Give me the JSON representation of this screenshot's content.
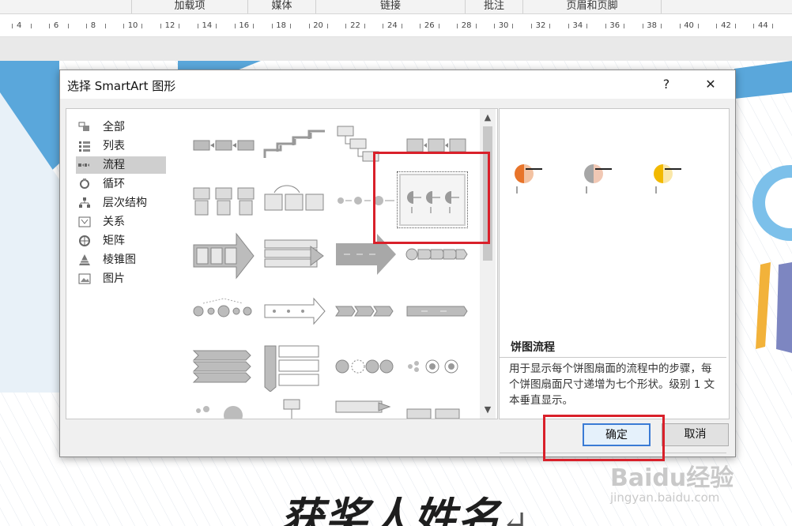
{
  "ribbon": {
    "groups": [
      "加载项",
      "媒体",
      "链接",
      "批注",
      "页眉和页脚"
    ]
  },
  "ruler": {
    "numbers": [
      "4",
      "6",
      "8",
      "10",
      "12",
      "14",
      "16",
      "18",
      "20",
      "22",
      "24",
      "26",
      "28",
      "30",
      "32",
      "34",
      "36",
      "38",
      "40",
      "42",
      "44"
    ]
  },
  "document": {
    "title_text": "获奖人姓名",
    "paragraph_mark": "↵"
  },
  "dialog": {
    "title": "选择 SmartArt 图形",
    "help_label": "?",
    "close_label": "✕",
    "categories": [
      {
        "label": "全部",
        "icon": "all-icon"
      },
      {
        "label": "列表",
        "icon": "list-icon"
      },
      {
        "label": "流程",
        "icon": "process-icon",
        "selected": true
      },
      {
        "label": "循环",
        "icon": "cycle-icon"
      },
      {
        "label": "层次结构",
        "icon": "hierarchy-icon"
      },
      {
        "label": "关系",
        "icon": "relationship-icon"
      },
      {
        "label": "矩阵",
        "icon": "matrix-icon"
      },
      {
        "label": "棱锥图",
        "icon": "pyramid-icon"
      },
      {
        "label": "图片",
        "icon": "picture-icon"
      }
    ],
    "selected_layout": "饼图流程",
    "preview": {
      "name": "饼图流程",
      "description": "用于显示每个饼图扇面的流程中的步骤，每个饼图扇面尺寸递增为七个形状。级别 1 文本垂直显示。",
      "colors": [
        "#e8742a",
        "#a6a6a6",
        "#f2b900"
      ]
    },
    "ok_label": "确定",
    "cancel_label": "取消"
  },
  "watermark": {
    "brand": "Baidu经验",
    "url": "jingyan.baidu.com"
  },
  "colors": {
    "highlight_red": "#d9202a",
    "accent_blue": "#3a7bd5",
    "deco_blue": "#5aa7db"
  }
}
